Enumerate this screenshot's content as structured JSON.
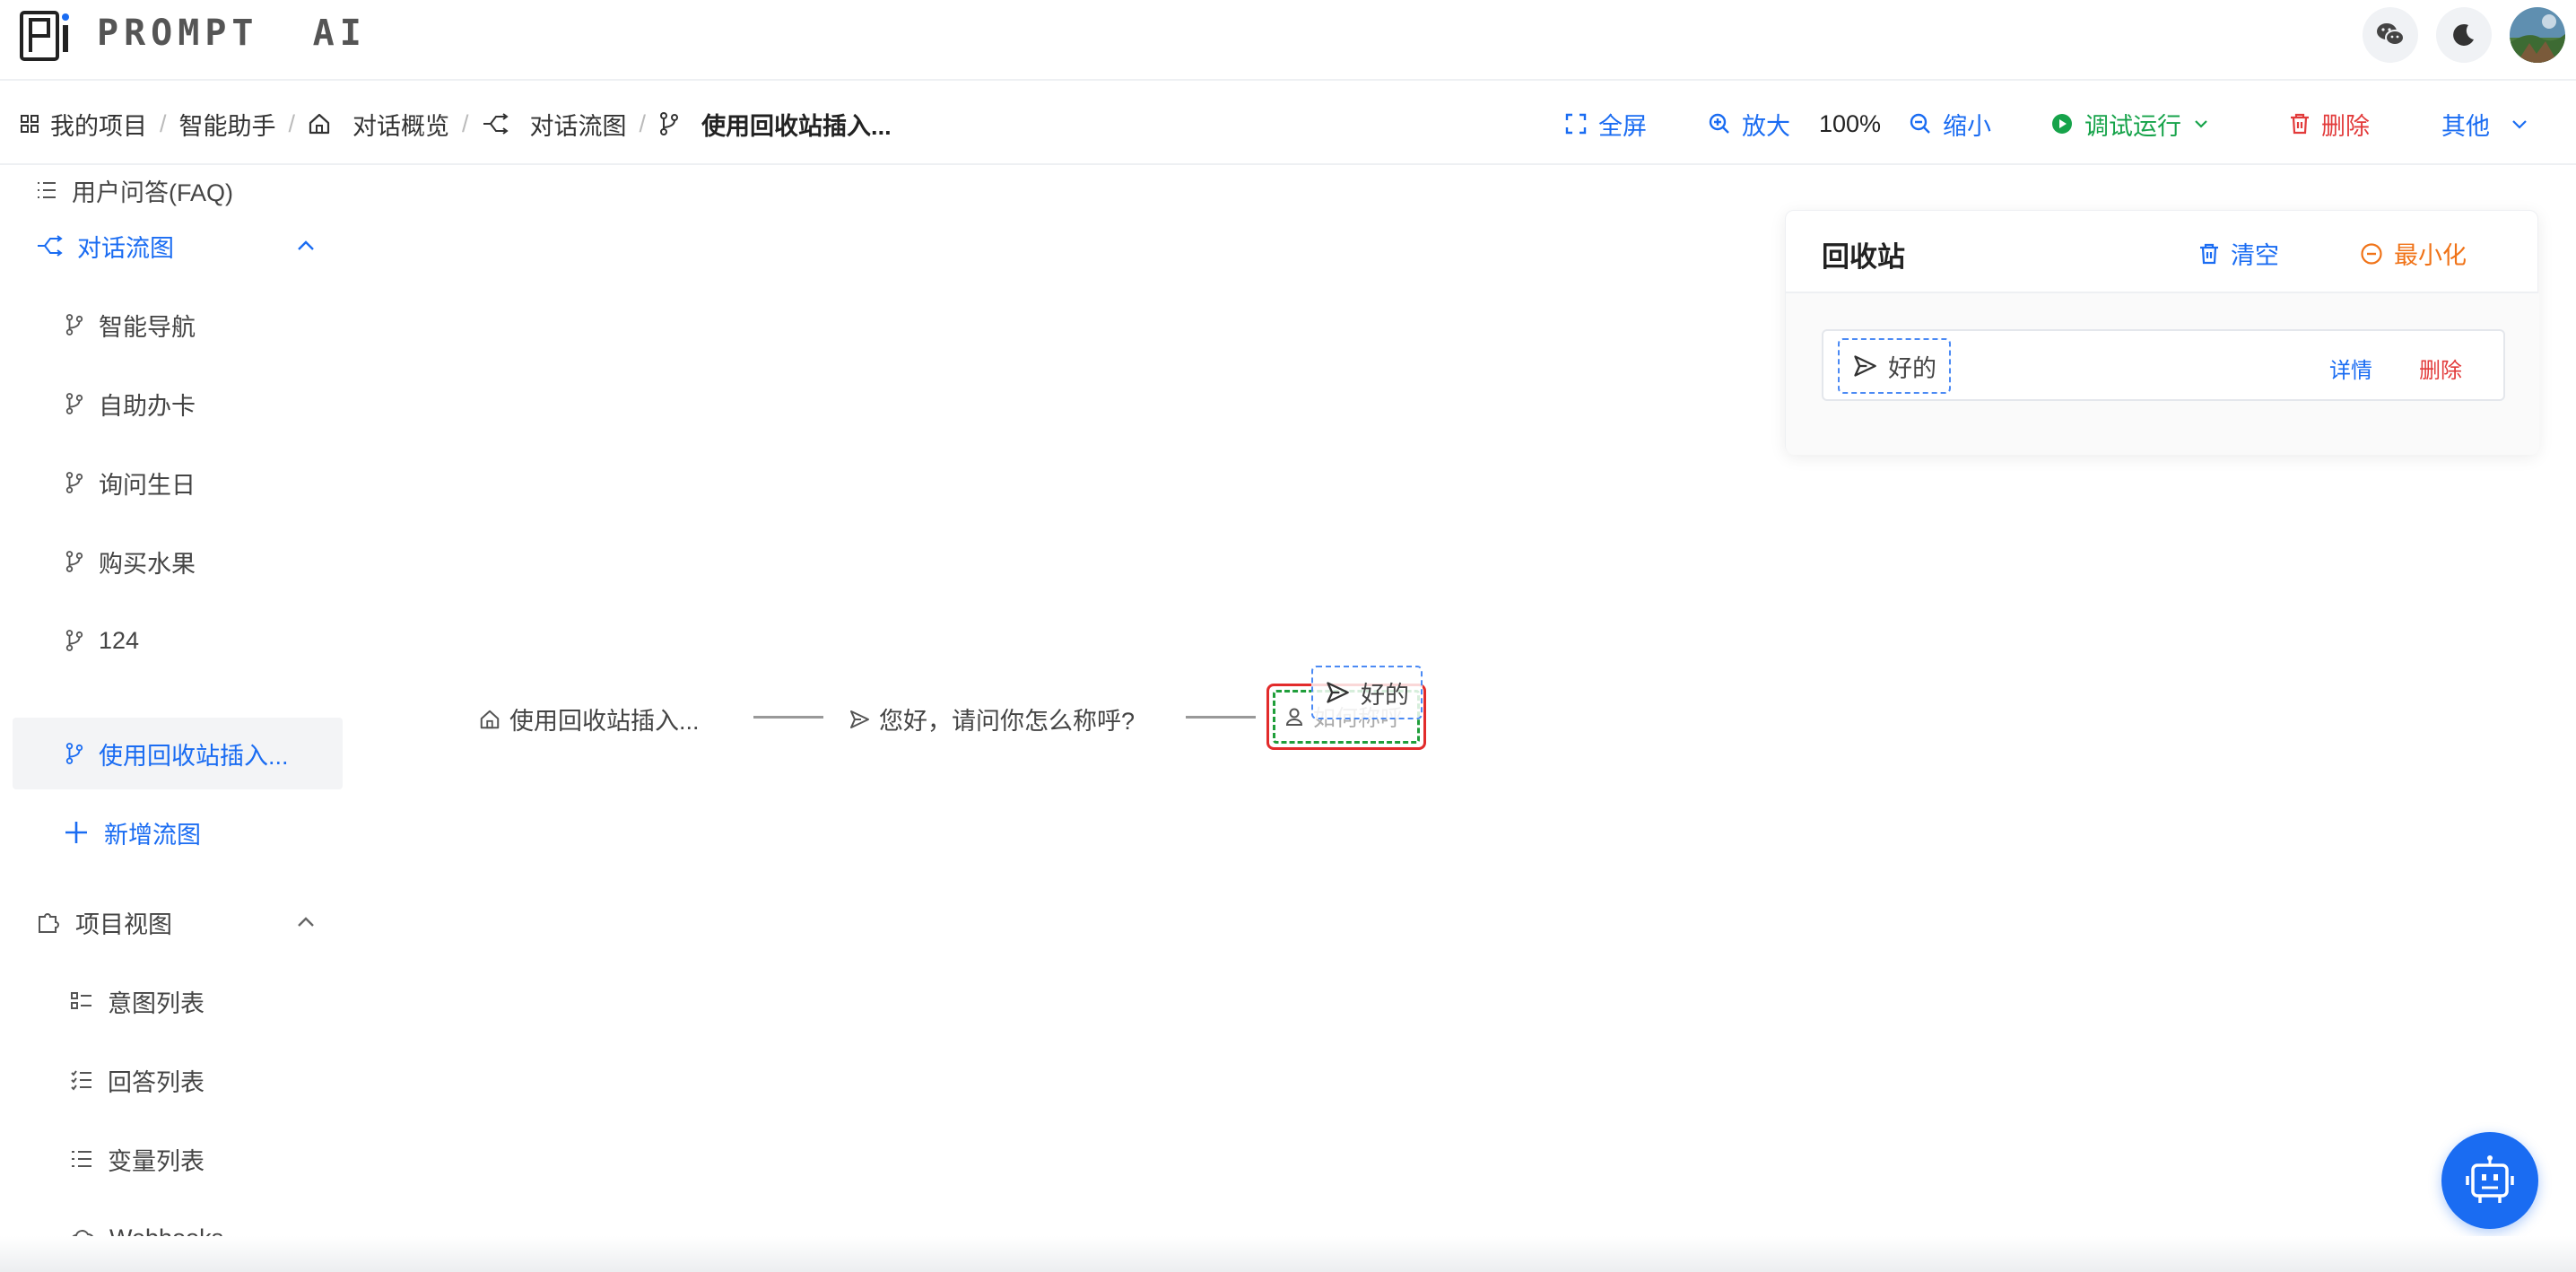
{
  "app": {
    "brand": "PROMPT  AI"
  },
  "breadcrumb": {
    "items": [
      "我的项目",
      "智能助手",
      "对话概览",
      "对话流图",
      "使用回收站插入..."
    ]
  },
  "toolbar": {
    "fullscreen": "全屏",
    "zoom_in": "放大",
    "zoom_level": "100%",
    "zoom_out": "缩小",
    "debug_run": "调试运行",
    "delete": "删除",
    "more": "其他"
  },
  "sidebar": {
    "faq": "用户问答(FAQ)",
    "flow_group": "对话流图",
    "flows": [
      "智能导航",
      "自助办卡",
      "询问生日",
      "购买水果",
      "124",
      "使用回收站插入..."
    ],
    "add_flow": "新增流图",
    "project_group": "项目视图",
    "views": [
      "意图列表",
      "回答列表",
      "变量列表",
      "Webhooks"
    ]
  },
  "canvas": {
    "start_node": "使用回收站插入...",
    "bot_node": "您好，请问你怎么称呼?",
    "user_node": "如何称呼",
    "drag_chip": "好的"
  },
  "recycle_bin": {
    "title": "回收站",
    "clear": "清空",
    "minimize": "最小化",
    "item_text": "好的",
    "detail": "详情",
    "delete": "删除"
  },
  "colors": {
    "accent": "#1a6cf2",
    "success": "#16a34a",
    "danger": "#e23b3b",
    "warning": "#f07318"
  }
}
